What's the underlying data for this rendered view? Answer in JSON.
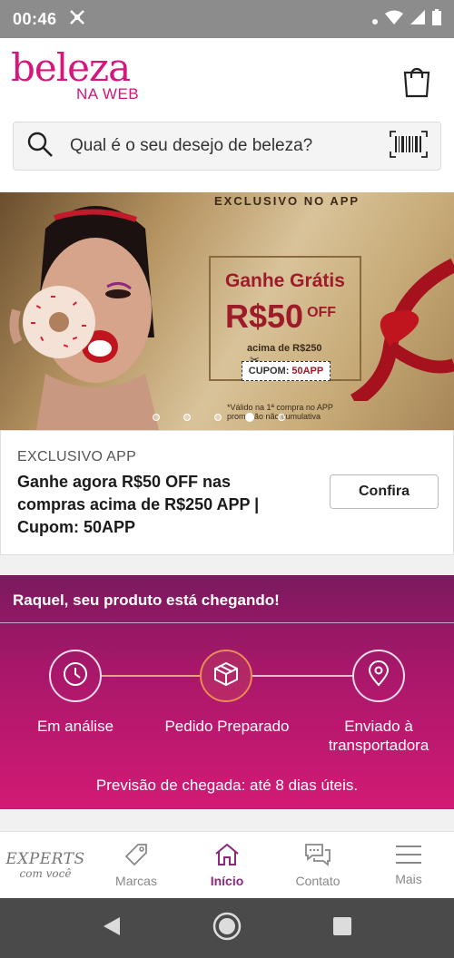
{
  "status_bar": {
    "time": "00:46"
  },
  "header": {
    "logo_main": "beleza",
    "logo_sub": "NA WEB"
  },
  "search": {
    "placeholder": "Qual é o seu desejo de beleza?"
  },
  "banner": {
    "tag": "EXCLUSIVO NO APP",
    "headline": "Ganhe Grátis",
    "amount": "R$50",
    "amount_suffix": "OFF",
    "condition": "acima de R$250",
    "coupon_label": "CUPOM:",
    "coupon_code": "50APP",
    "legal": "*Válido na 1ª compra no APP promoção não cumulativa",
    "slides_total": 5,
    "slide_active_index": 3
  },
  "promo_card": {
    "label": "EXCLUSIVO APP",
    "description": "Ganhe agora R$50 OFF nas compras acima de R$250 APP | Cupom: 50APP",
    "button": "Confira"
  },
  "tracking": {
    "title": "Raquel, seu produto está chegando!",
    "steps": [
      {
        "label": "Em análise",
        "icon": "clock-icon"
      },
      {
        "label": "Pedido Preparado",
        "icon": "package-icon"
      },
      {
        "label": "Enviado à transportadora",
        "icon": "location-pin-icon"
      }
    ],
    "active_step": 1,
    "forecast": "Previsão de chegada: até 8 dias úteis."
  },
  "bottom_nav": {
    "experts_title": "EXPERTS",
    "experts_sub": "com você",
    "items": [
      {
        "label": "Marcas",
        "icon": "tag-icon"
      },
      {
        "label": "Início",
        "icon": "home-icon"
      },
      {
        "label": "Contato",
        "icon": "chat-icon"
      },
      {
        "label": "Mais",
        "icon": "menu-icon"
      }
    ],
    "active": "Início"
  },
  "colors": {
    "brand": "#d4177b",
    "tracking_top": "#7a1a5e",
    "tracking_bottom": "#d31a74",
    "nav_active": "#8a2a7d",
    "step_active": "#e98b52"
  }
}
